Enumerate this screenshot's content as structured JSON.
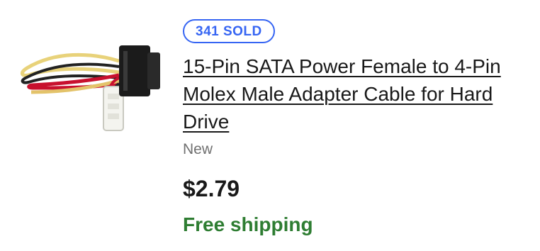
{
  "listing": {
    "sold_badge": "341 SOLD",
    "title": "15-Pin SATA Power Female to 4-Pin Molex Male Adapter Cable for Hard Drive",
    "condition": "New",
    "price": "$2.79",
    "shipping": "Free shipping",
    "image_icon": "sata-molex-cable-image",
    "colors": {
      "badge": "#3665f3",
      "shipping": "#2e7d32",
      "condition": "#707070",
      "text": "#191919"
    }
  }
}
